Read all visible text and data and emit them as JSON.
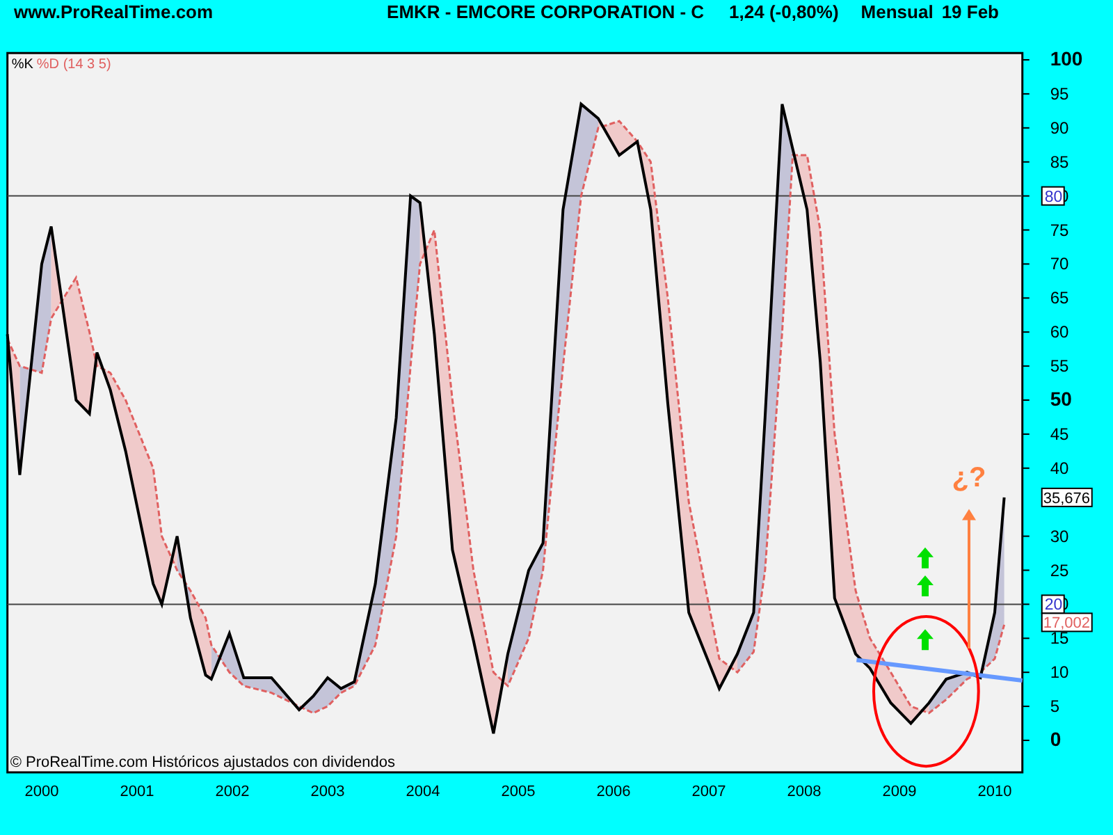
{
  "header": {
    "site": "www.ProRealTime.com",
    "title": "EMKR - EMCORE CORPORATION - C",
    "price": "1,24 (-0,80%)",
    "period": "Mensual",
    "date": "19 Feb"
  },
  "legend_params": "(14 3 5)",
  "footer": "© ProRealTime.com  Históricos ajustados con dividendos",
  "last_values": [
    {
      "label": "35,676",
      "color": "#000000"
    },
    {
      "label": "17,002",
      "color": "#e06060"
    }
  ],
  "note": "¿?",
  "chart_data": {
    "type": "line",
    "x": [
      1999.64,
      1999.77,
      2000.0,
      2000.1,
      2000.36,
      2000.5,
      2000.58,
      2000.72,
      2000.88,
      2001.17,
      2001.26,
      2001.42,
      2001.56,
      2001.72,
      2001.78,
      2001.97,
      2002.12,
      2002.41,
      2002.7,
      2002.85,
      2003.0,
      2003.14,
      2003.28,
      2003.5,
      2003.72,
      2003.87,
      2003.97,
      2004.12,
      2004.31,
      2004.53,
      2004.74,
      2004.89,
      2005.11,
      2005.26,
      2005.47,
      2005.66,
      2005.84,
      2006.06,
      2006.25,
      2006.39,
      2006.57,
      2006.79,
      2007.11,
      2007.3,
      2007.47,
      2007.59,
      2007.77,
      2007.88,
      2008.03,
      2008.17,
      2008.32,
      2008.54,
      2008.69,
      2008.91,
      2009.12,
      2009.31,
      2009.49,
      2009.71,
      2009.85,
      2010.0,
      2010.1
    ],
    "series": [
      {
        "name": "%K",
        "color": "#000000",
        "values": [
          59.7,
          39,
          70,
          75.5,
          50,
          48,
          57,
          51.5,
          42.5,
          23,
          20,
          30,
          18,
          9.6,
          9,
          15.7,
          9.2,
          9.2,
          4.5,
          6.5,
          9.2,
          7.6,
          8.6,
          23,
          47.4,
          80,
          79,
          59.7,
          28,
          14.7,
          1,
          12.7,
          25,
          29,
          78,
          93.5,
          91.4,
          86,
          88,
          78,
          49.5,
          18.8,
          7.6,
          12.7,
          18.8,
          47.4,
          93.5,
          86.9,
          78,
          55.6,
          20.9,
          12.7,
          10.6,
          5.5,
          2.5,
          5.5,
          9,
          10,
          9.2,
          18.8,
          35.7
        ]
      },
      {
        "name": "%D",
        "color": "#e06060",
        "line_style": "dashed",
        "values": [
          59,
          55,
          54,
          62,
          68,
          60,
          55,
          54,
          50,
          40,
          30,
          25,
          22,
          18,
          14,
          10,
          8,
          7,
          5,
          4,
          5,
          7,
          8,
          14,
          30,
          55,
          70,
          75,
          50,
          25,
          10,
          8,
          15,
          25,
          55,
          80,
          90,
          91,
          88,
          85,
          65,
          35,
          12,
          10,
          13,
          25,
          60,
          86,
          86,
          75,
          45,
          22,
          15,
          10,
          5,
          4,
          6,
          9,
          10,
          12,
          17
        ]
      }
    ],
    "xlim": [
      1999.64,
      2010.29
    ],
    "ylim": [
      -4.7,
      101
    ],
    "xticks": [
      2000,
      2001,
      2002,
      2003,
      2004,
      2005,
      2006,
      2007,
      2008,
      2009,
      2010
    ],
    "yticks": [
      0,
      5,
      10,
      15,
      20,
      25,
      30,
      40,
      45,
      50,
      55,
      60,
      65,
      70,
      75,
      80,
      85,
      90,
      95,
      100
    ],
    "ref_lines": [
      {
        "axis": "y",
        "value": 80,
        "label": "80"
      },
      {
        "axis": "y",
        "value": 20,
        "label": "20"
      }
    ]
  }
}
